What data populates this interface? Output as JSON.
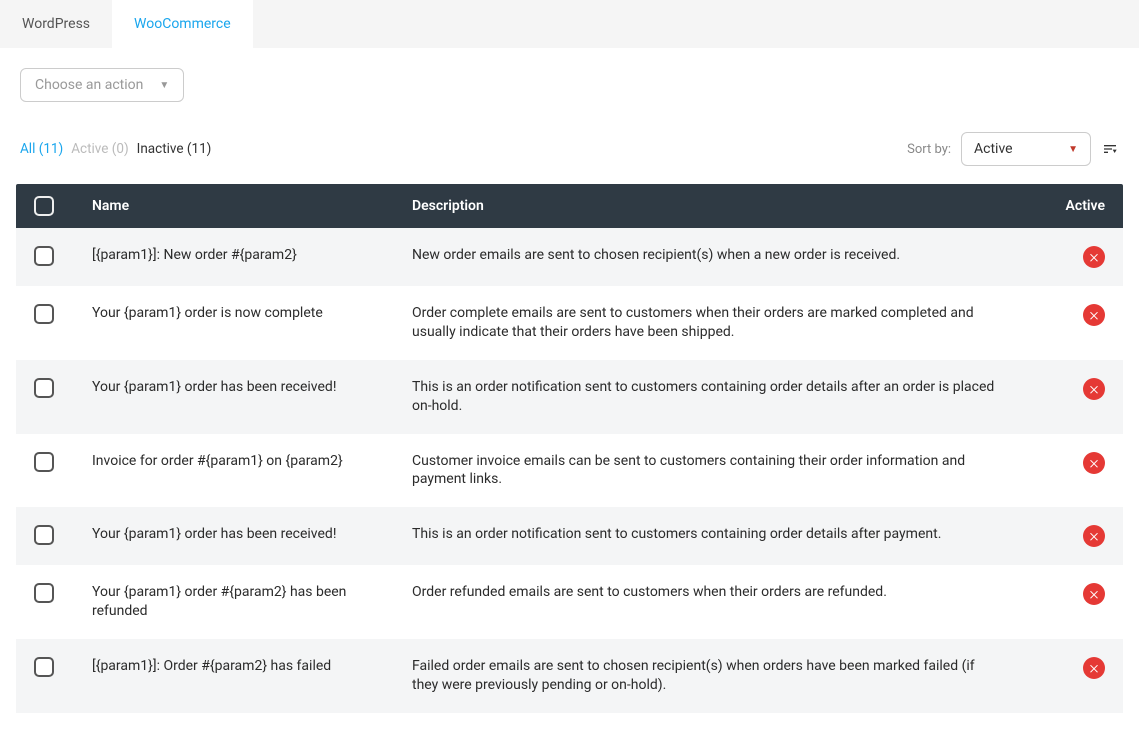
{
  "tabs": [
    {
      "label": "WordPress",
      "active": false
    },
    {
      "label": "WooCommerce",
      "active": true
    }
  ],
  "action_placeholder": "Choose an action",
  "filters": {
    "all": "All (11)",
    "active": "Active (0)",
    "inactive": "Inactive (11)"
  },
  "sort": {
    "label": "Sort by:",
    "value": "Active"
  },
  "columns": {
    "name": "Name",
    "description": "Description",
    "active": "Active"
  },
  "rows": [
    {
      "name": "[{param1}]: New order #{param2}",
      "desc": "New order emails are sent to chosen recipient(s) when a new order is received."
    },
    {
      "name": "Your {param1} order is now complete",
      "desc": "Order complete emails are sent to customers when their orders are marked completed and usually indicate that their orders have been shipped."
    },
    {
      "name": "Your {param1} order has been received!",
      "desc": "This is an order notification sent to customers containing order details after an order is placed on-hold."
    },
    {
      "name": "Invoice for order #{param1} on {param2}",
      "desc": "Customer invoice emails can be sent to customers containing their order information and payment links."
    },
    {
      "name": "Your {param1} order has been received!",
      "desc": "This is an order notification sent to customers containing order details after payment."
    },
    {
      "name": "Your {param1} order #{param2} has been refunded",
      "desc": "Order refunded emails are sent to customers when their orders are refunded."
    },
    {
      "name": "[{param1}]: Order #{param2} has failed",
      "desc": "Failed order emails are sent to chosen recipient(s) when orders have been marked failed (if they were previously pending or on-hold)."
    }
  ]
}
